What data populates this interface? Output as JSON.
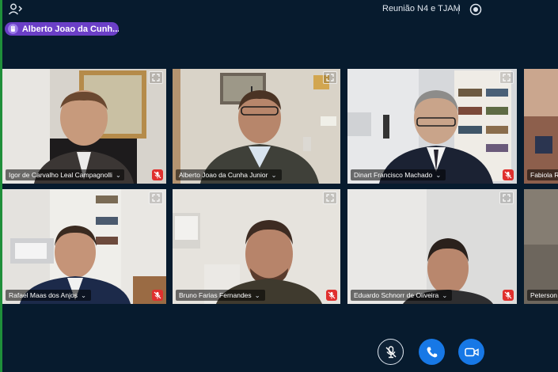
{
  "topbar": {
    "meeting_title": "Reunião N4 e TJAM",
    "users_icon": "users-icon",
    "record_icon": "record-icon"
  },
  "presenter": {
    "name": "Alberto Joao da Cunh..."
  },
  "participants": [
    {
      "name": "Igor de Carvalho Leal Campagnolli",
      "muted": true
    },
    {
      "name": "Alberto Joao da Cunha Junior",
      "muted": false
    },
    {
      "name": "Dinart Francisco Machado",
      "muted": true
    },
    {
      "name": "Fabiola R",
      "muted": false
    },
    {
      "name": "Rafael Maas dos Anjos",
      "muted": true
    },
    {
      "name": "Bruno Farias Fernandes",
      "muted": true
    },
    {
      "name": "Eduardo Schnorr de Oliveira",
      "muted": true
    },
    {
      "name": "Peterson",
      "muted": false
    }
  ],
  "controls": {
    "mic_icon": "mic-off-icon",
    "hangup_icon": "phone-icon",
    "camera_icon": "video-camera-icon"
  },
  "colors": {
    "background": "#071b2e",
    "accent_purple": "#6b3fc7",
    "button_blue": "#1778e6",
    "muted_red": "#e0302e"
  }
}
